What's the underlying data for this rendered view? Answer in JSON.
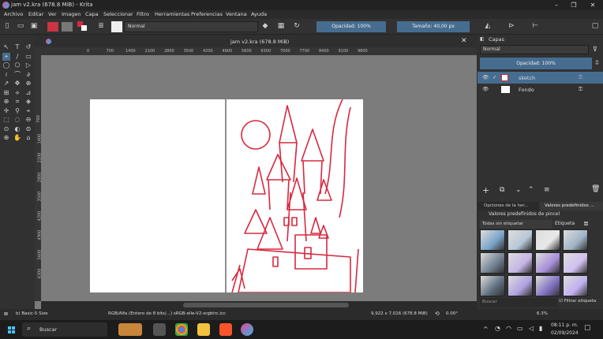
{
  "window": {
    "title": "jam v2.kra (678.8 MiB)  -  Krita"
  },
  "menu": [
    "Archivo",
    "Editar",
    "Ver",
    "Imagen",
    "Capa",
    "Seleccionar",
    "Filtro",
    "Herramientas",
    "Preferencias",
    "Ventana",
    "Ayuda"
  ],
  "toolbar": {
    "blend_mode": "Normal",
    "opacity_label": "Opacidad: 100%",
    "size_label": "Tamaño: 40,00 px"
  },
  "document_tab": {
    "title": "jam v2.kra (678.8 MiB)"
  },
  "ruler_ticks": [
    "0",
    "700",
    "1400",
    "2100",
    "2800",
    "3500",
    "4200",
    "4900",
    "5600",
    "6300",
    "7000",
    "7700",
    "8400",
    "9100",
    "9800"
  ],
  "ruler_left_ticks": [
    "700",
    "1400",
    "2100",
    "2800",
    "3500",
    "4200",
    "4900",
    "5600",
    "6300"
  ],
  "layers_panel": {
    "title": "Capas",
    "blend_mode": "Normal",
    "opacity_label": "Opacidad:  100%",
    "layers": [
      {
        "name": "sketch",
        "selected": true
      },
      {
        "name": "Fondo",
        "selected": false
      }
    ]
  },
  "presets_panel": {
    "tabs": [
      "Opciones de la her...",
      "Valores predefinidos ..."
    ],
    "title": "Valores predefinidos de pincel",
    "tag_filter": "Todas sin etiquetar",
    "tag_label": "Etiqueta",
    "search_placeholder": "Buscar",
    "filter_label": "Filtrar etiqueta"
  },
  "status": {
    "brush": "b) Basic-5 Size",
    "color_model": "RGB/Alfa (Entero de 8 bits/...)  sRGB-elle-V2-srgbtrc.icc",
    "dimensions": "9,922 x 7,016 (678.8 MiB)",
    "rotation": "0.00°",
    "zoom": "6.3%"
  },
  "taskbar": {
    "search_placeholder": "Buscar",
    "time": "08:11 p. m.",
    "date": "02/09/2024"
  },
  "colors": {
    "accent": "#466d90",
    "sketch": "#d8283e"
  }
}
